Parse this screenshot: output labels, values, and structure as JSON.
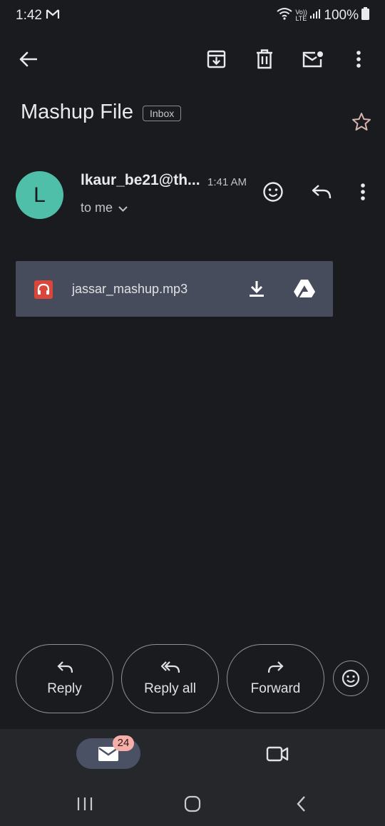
{
  "status_bar": {
    "time": "1:42",
    "battery": "100%",
    "network_label": "Vo)) LTE"
  },
  "toolbar": {
    "back_icon": "arrow-left-icon",
    "archive_icon": "archive-icon",
    "delete_icon": "trash-icon",
    "mark_unread_icon": "mail-unread-icon",
    "more_icon": "more-vert-icon"
  },
  "email": {
    "subject": "Mashup File",
    "label": "Inbox",
    "sender": "lkaur_be21@th...",
    "sender_initial": "L",
    "time": "1:41 AM",
    "recipient": "to me",
    "avatar_color": "#4fbfaa"
  },
  "attachment": {
    "filename": "jassar_mashup.mp3",
    "type_icon": "audio-file-icon",
    "type_color": "#d9473b"
  },
  "actions": {
    "reply": "Reply",
    "reply_all": "Reply all",
    "forward": "Forward"
  },
  "bottom_nav": {
    "mail_badge": "24",
    "badge_color": "#f6aea9"
  },
  "theme": {
    "background": "#1a1b1e",
    "attachment_bg": "#474c5c",
    "nav_bg": "#25272b"
  }
}
